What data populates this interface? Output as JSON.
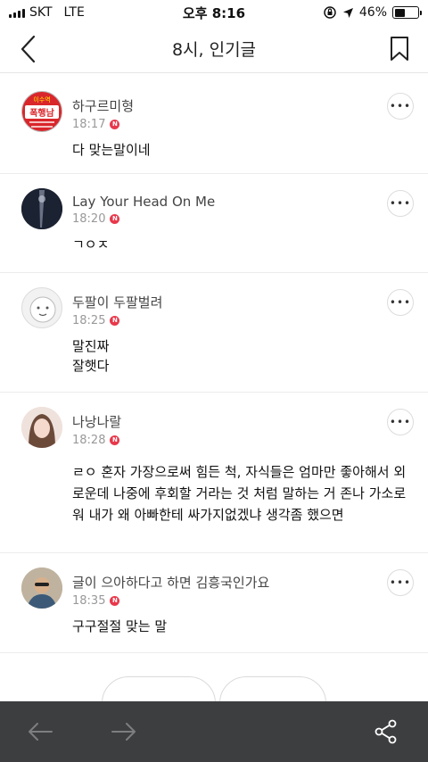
{
  "statusbar": {
    "carrier": "SKT",
    "network": "LTE",
    "time": "오후 8:16",
    "battery_percent": "46%",
    "battery_level": 0.46
  },
  "header": {
    "title": "8시, 인기글",
    "icons": {
      "back": "chevron-left-icon",
      "bookmark": "bookmark-icon"
    }
  },
  "comments": [
    {
      "author": "하구르미형",
      "time": "18:17",
      "badge": "N",
      "text": "다 맞는말이네",
      "avatar_label": "폭행남",
      "avatar_top_text": "이수역"
    },
    {
      "author": "Lay Your Head On Me",
      "time": "18:20",
      "badge": "N",
      "text": "ㄱㅇㅈ"
    },
    {
      "author": "두팔이 두팔벌려",
      "time": "18:25",
      "badge": "N",
      "text": "말진짜\n잘햇다"
    },
    {
      "author": "나낭나랄",
      "time": "18:28",
      "badge": "N",
      "text": "ㄹㅇ 혼자 가장으로써 힘든 척, 자식들은 엄마만 좋아해서 외로운데 나중에 후회할 거라는 것 처럼 말하는 거 존나 가소로워 내가 왜 아빠한테 싸가지없겠냐 생각좀 했으면"
    },
    {
      "author": "글이 으아하다고 하면 김흥국인가요",
      "time": "18:35",
      "badge": "N",
      "text": "구구절절 맞는 말"
    }
  ],
  "bottombar": {
    "icons": {
      "back": "arrow-left-icon",
      "forward": "arrow-right-icon",
      "share": "share-icon"
    }
  },
  "colors": {
    "accent_red": "#e8384b",
    "bottombar_bg": "#3d3e40"
  }
}
